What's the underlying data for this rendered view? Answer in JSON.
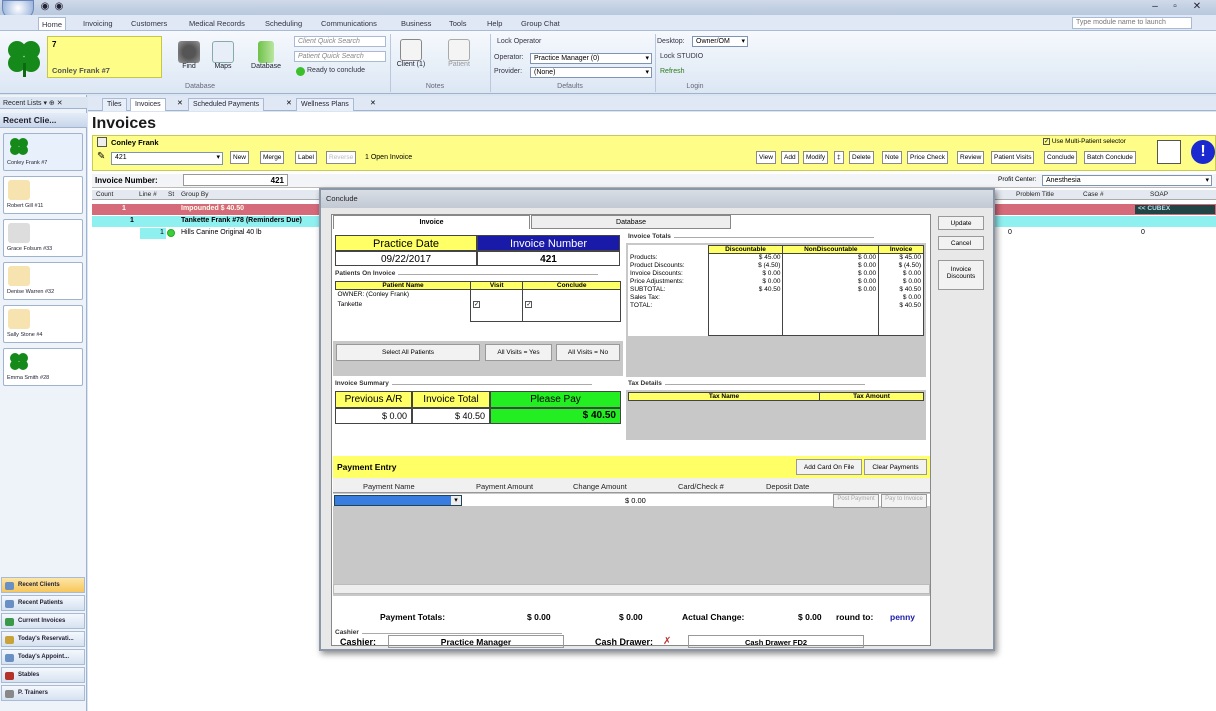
{
  "app": {
    "module_search_placeholder": "Type module name to launch"
  },
  "menu": {
    "tabs": [
      "Home",
      "Invoicing",
      "Customers",
      "Medical Records",
      "Scheduling",
      "Communications",
      "Business",
      "Tools",
      "Help",
      "Group Chat"
    ]
  },
  "ribbon": {
    "client_number": "7",
    "client_name": "Conley Frank #7",
    "find": "Find",
    "maps": "Maps",
    "database": "Database",
    "client_quick_search": "Client Quick Search",
    "patient_quick_search": "Patient Quick Search",
    "ready_to_conclude": "Ready to conclude",
    "group_database": "Database",
    "client_notes": "Client (1)",
    "patient_notes": "Patient",
    "group_notes": "Notes",
    "lock_operator": "Lock Operator",
    "operator_label": "Operator:",
    "operator_value": "Practice Manager (0)",
    "provider_label": "Provider:",
    "provider_value": "(None)",
    "group_defaults": "Defaults",
    "desktop_label": "Desktop:",
    "desktop_value": "Owner/OM",
    "lock_studio": "Lock STUDIO",
    "refresh": "Refresh",
    "group_login": "Login"
  },
  "left": {
    "recent_lists": "Recent Lists ▾ ⊕ ✕",
    "recent_clients_header": "Recent Clie...",
    "clients": [
      "Conley Frank #7",
      "Robert Gill #11",
      "Grace Folsum #33",
      "Denise Warren #32",
      "Sally Stone #4",
      "Emma Smith #28"
    ],
    "nav": [
      "Recent Clients",
      "Recent Patients",
      "Current Invoices",
      "Today's Reservati...",
      "Today's Appoint...",
      "Stables",
      "P. Trainers"
    ]
  },
  "doc_tabs": [
    "Tiles",
    "Invoices",
    "Scheduled Payments",
    "Wellness Plans"
  ],
  "invoices": {
    "title": "Invoices",
    "client": "Conley Frank",
    "invoice_combo": "421",
    "buttons_left": [
      "New",
      "Merge",
      "Label",
      "Reverse"
    ],
    "open_invoice": "1 Open Invoice",
    "buttons_right": [
      "View",
      "Add",
      "Modify",
      "Delete",
      "Note",
      "Price Check",
      "Review",
      "Patient Visits",
      "Conclude",
      "Batch Conclude"
    ],
    "multi_patient": "Use Multi-Patient selector",
    "profit_center_label": "Profit Center:",
    "profit_center_value": "Anesthesia",
    "invoice_number_label": "Invoice Number:",
    "invoice_number_value": "421",
    "grid_headers": [
      "Count",
      "Line #",
      "St",
      "Group By",
      "Problem Title",
      "Case #",
      "SOAP"
    ],
    "rows": [
      {
        "count": "1",
        "line": "",
        "group": "Impounded   $ 40.50"
      },
      {
        "count": "1",
        "line": "",
        "group": "Tankette Frank #78 (Reminders Due)"
      },
      {
        "count": "",
        "line": "1",
        "group": "Hills Canine Original 40 lb"
      }
    ],
    "row_zero_a": "0",
    "row_zero_b": "0",
    "soap": "<< CUBEX"
  },
  "dialog": {
    "title": "Conclude",
    "tab_invoice": "Invoice",
    "tab_database": "Database",
    "side_buttons": [
      "Update",
      "Cancel",
      "Invoice Discounts"
    ],
    "practice_date_label": "Practice Date",
    "practice_date": "09/22/2017",
    "invoice_number_label": "Invoice Number",
    "invoice_number": "421",
    "patients_group": "Patients On Invoice",
    "patients_headers": [
      "Patient Name",
      "Visit",
      "Conclude"
    ],
    "patients": [
      {
        "name": "OWNER: (Conley Frank)",
        "visit": "",
        "conclude": ""
      },
      {
        "name": "Tankette",
        "visit": "✓",
        "conclude": "✓"
      }
    ],
    "select_all": "Select All Patients",
    "all_visits_yes": "All Visits = Yes",
    "all_visits_no": "All Visits = No",
    "totals_group": "Invoice Totals",
    "totals_headers": [
      "",
      "Discountable",
      "NonDiscountable",
      "Invoice"
    ],
    "totals_rows": [
      [
        "Products:",
        "$ 45.00",
        "$ 0.00",
        "$ 45.00"
      ],
      [
        "Product Discounts:",
        "$ (4.50)",
        "$ 0.00",
        "$ (4.50)"
      ],
      [
        "Invoice Discounts:",
        "$ 0.00",
        "$ 0.00",
        "$ 0.00"
      ],
      [
        "Price Adjustments:",
        "$ 0.00",
        "$ 0.00",
        "$ 0.00"
      ],
      [
        "SUBTOTAL:",
        "$ 40.50",
        "$ 0.00",
        "$ 40.50"
      ],
      [
        "Sales Tax:",
        "",
        "",
        "$ 0.00"
      ],
      [
        "TOTAL:",
        "",
        "",
        "$ 40.50"
      ]
    ],
    "summary_group": "Invoice Summary",
    "prev_ar_label": "Previous A/R",
    "invoice_total_label": "Invoice Total",
    "please_pay_label": "Please Pay",
    "prev_ar": "$ 0.00",
    "invoice_total": "$ 40.50",
    "please_pay": "$ 40.50",
    "tax_group": "Tax Details",
    "tax_headers": [
      "Tax Name",
      "Tax Amount"
    ],
    "payment_entry": "Payment Entry",
    "add_card": "Add Card On File",
    "clear_payments": "Clear Payments",
    "payment_headers": [
      "Payment Name",
      "Payment Amount",
      "Change Amount",
      "Card/Check #",
      "Deposit Date"
    ],
    "change_amount": "$ 0.00",
    "post_payment": "Post Payment",
    "pay_to_invoice": "Pay to Invoice",
    "payment_totals_label": "Payment Totals:",
    "payment_total_a": "$ 0.00",
    "payment_total_b": "$ 0.00",
    "actual_change_label": "Actual Change:",
    "actual_change": "$ 0.00",
    "round_to_label": "round to:",
    "round_to": "penny",
    "cashier_group": "Cashier",
    "cashier_label": "Cashier:",
    "cashier": "Practice Manager",
    "cash_drawer_label": "Cash Drawer:",
    "cash_drawer": "Cash Drawer FD2"
  },
  "colors": {
    "yellow": "#fdfd88",
    "blue_header": "#1a1aa8",
    "green": "#22ee22",
    "selection": "#3a7de0"
  }
}
